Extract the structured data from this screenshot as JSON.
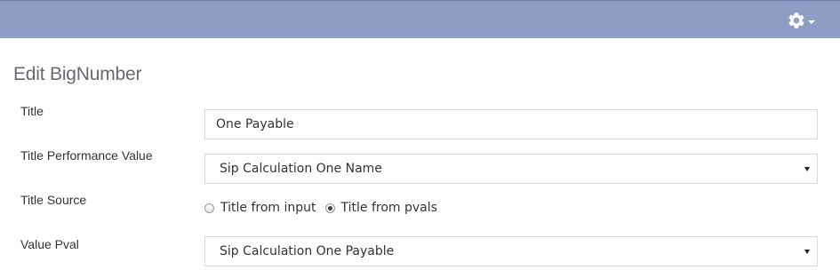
{
  "topbar": {
    "settings_icon": "gear-icon",
    "caret_icon": "caret-down-icon"
  },
  "page": {
    "title": "Edit BigNumber"
  },
  "form": {
    "title": {
      "label": "Title",
      "value": "One Payable"
    },
    "title_performance_value": {
      "label": "Title Performance Value",
      "selected": "Sip Calculation One Name"
    },
    "title_source": {
      "label": "Title Source",
      "options": [
        {
          "label": "Title from input",
          "checked": false
        },
        {
          "label": "Title from pvals",
          "checked": true
        }
      ]
    },
    "value_pval": {
      "label": "Value Pval",
      "selected": "Sip Calculation One Payable"
    }
  },
  "colors": {
    "topbar_bg": "#8e9ec4",
    "title_text": "#666a70"
  }
}
